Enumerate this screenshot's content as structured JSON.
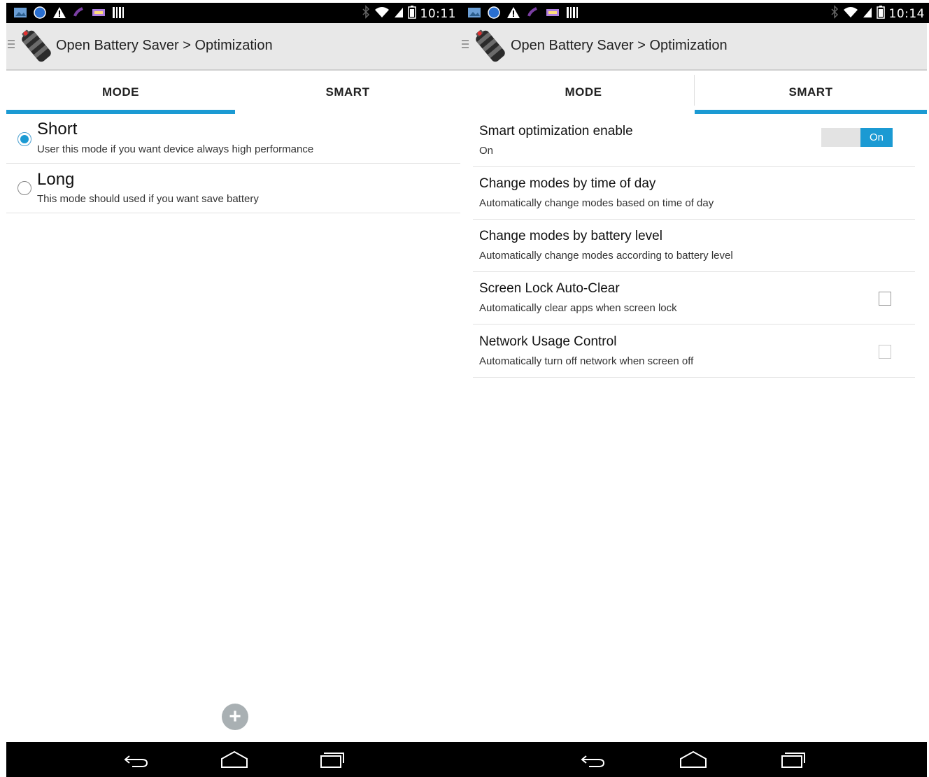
{
  "left": {
    "status_bar": {
      "icons": [
        "gallery-icon",
        "counter-100-icon",
        "warning-icon",
        "phone-icon",
        "notification-icon",
        "barcode-icon"
      ],
      "right_icons": [
        "bluetooth-icon",
        "wifi-icon",
        "signal-icon",
        "battery-icon"
      ],
      "time": "10:11"
    },
    "action_bar": {
      "title": "Open Battery Saver > Optimization"
    },
    "tabs": [
      {
        "label": "MODE",
        "selected": true
      },
      {
        "label": "SMART",
        "selected": false
      }
    ],
    "modes": [
      {
        "title": "Short",
        "subtitle": "User this mode if you want device always high performance",
        "selected": true
      },
      {
        "title": "Long",
        "subtitle": "This mode should used if you want save battery",
        "selected": false
      }
    ],
    "fab": {
      "icon": "add-icon",
      "glyph": "+"
    }
  },
  "right": {
    "status_bar": {
      "icons": [
        "gallery-icon",
        "counter-100-icon",
        "warning-icon",
        "phone-icon",
        "notification-icon",
        "barcode-icon"
      ],
      "right_icons": [
        "bluetooth-icon",
        "wifi-icon",
        "signal-icon",
        "battery-icon"
      ],
      "time": "10:14"
    },
    "action_bar": {
      "title": "Open Battery Saver > Optimization"
    },
    "tabs": [
      {
        "label": "MODE",
        "selected": false
      },
      {
        "label": "SMART",
        "selected": true
      }
    ],
    "prefs": [
      {
        "title": "Smart optimization enable",
        "subtitle": "On",
        "control": "switch",
        "switch_label": "On",
        "checked": true
      },
      {
        "title": "Change modes by time of day",
        "subtitle": "Automatically change modes based on time of day",
        "control": "none"
      },
      {
        "title": "Change modes by battery level",
        "subtitle": "Automatically change modes according to battery level",
        "control": "none"
      },
      {
        "title": "Screen Lock Auto-Clear",
        "subtitle": "Automatically clear apps when screen lock",
        "control": "checkbox",
        "checked": false
      },
      {
        "title": "Network Usage Control",
        "subtitle": "Automatically turn off network when screen off",
        "control": "checkbox",
        "checked": false
      }
    ]
  },
  "nav_bar": {
    "buttons": [
      "back-icon",
      "home-icon",
      "recent-apps-icon"
    ]
  },
  "colors": {
    "accent": "#1b9ad3",
    "action_bar": "#e8e8e8",
    "status_bar": "#000000"
  }
}
